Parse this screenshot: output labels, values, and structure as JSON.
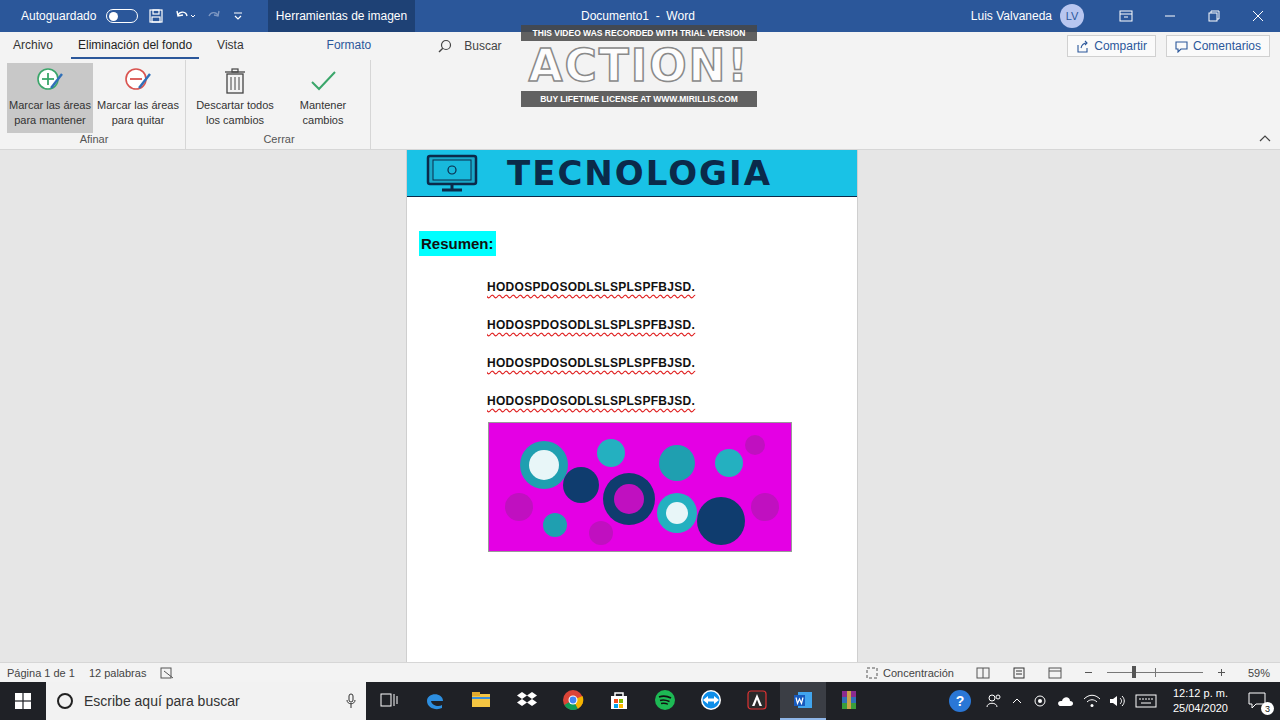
{
  "title_bar": {
    "autosave_label": "Autoguardado",
    "autosave_on": false,
    "context_tab": "Herramientas de imagen",
    "title": "Documento1  -  Word",
    "user": "Luis Valvaneda",
    "initials": "LV"
  },
  "watermark": {
    "top": "THIS VIDEO WAS RECORDED WITH TRIAL VERSION",
    "logo": "ACTION!",
    "bottom": "BUY LIFETIME LICENSE AT WWW.MIRILLIS.COM"
  },
  "tabs": [
    {
      "label": "Archivo",
      "selected": false,
      "kind": "normal"
    },
    {
      "label": "Eliminación del fondo",
      "selected": true,
      "kind": "normal"
    },
    {
      "label": "Vista",
      "selected": false,
      "kind": "normal"
    },
    {
      "label": "Formato",
      "selected": false,
      "kind": "contextual"
    }
  ],
  "search": {
    "placeholder": "Buscar"
  },
  "actions": {
    "share": "Compartir",
    "comments": "Comentarios"
  },
  "ribbon_groups": [
    {
      "label": "Afinar",
      "buttons": [
        {
          "label": "Marcar las áreas para mantener",
          "kind": "keep",
          "hovered": true
        },
        {
          "label": "Marcar las áreas para quitar",
          "kind": "remove",
          "hovered": false
        }
      ]
    },
    {
      "label": "Cerrar",
      "buttons": [
        {
          "label": "Descartar todos los cambios",
          "kind": "discard",
          "hovered": false
        },
        {
          "label": "Mantener cambios",
          "kind": "accept",
          "hovered": false
        }
      ]
    }
  ],
  "document": {
    "heading": "TECNOLOGIA",
    "subheading": "Resumen:",
    "lines": [
      {
        "text": "HODOSPDOSODLSLSPLSPFBJSD.",
        "misspelled": true
      },
      {
        "text": "HODOSPDOSODLSLSPLSPFBJSD.",
        "misspelled": true
      },
      {
        "text": "HODOSPDOSODLSLSPLSPFBJSD.",
        "misspelled": true
      },
      {
        "text": "HODOSPDOSODLSLSPLSPFBJSD.",
        "misspelled": true
      }
    ]
  },
  "status_bar": {
    "page": "Página 1 de 1",
    "words": "12 palabras",
    "focus": "Concentración",
    "zoom": "59%",
    "zoom_level": 0.28
  },
  "taskbar": {
    "search_placeholder": "Escribe aquí para buscar",
    "apps": [
      {
        "kind": "taskview",
        "active": false
      },
      {
        "kind": "edge",
        "active": false
      },
      {
        "kind": "explorer",
        "active": false
      },
      {
        "kind": "dropbox",
        "active": false
      },
      {
        "kind": "chrome",
        "active": false
      },
      {
        "kind": "store",
        "active": false
      },
      {
        "kind": "spotify",
        "active": false
      },
      {
        "kind": "teamviewer",
        "active": false
      },
      {
        "kind": "action",
        "active": false
      },
      {
        "kind": "word",
        "active": true
      },
      {
        "kind": "winrar",
        "active": false
      }
    ],
    "help": "?",
    "time": "12:12 p. m.",
    "date": "25/04/2020",
    "notifications": "3"
  }
}
